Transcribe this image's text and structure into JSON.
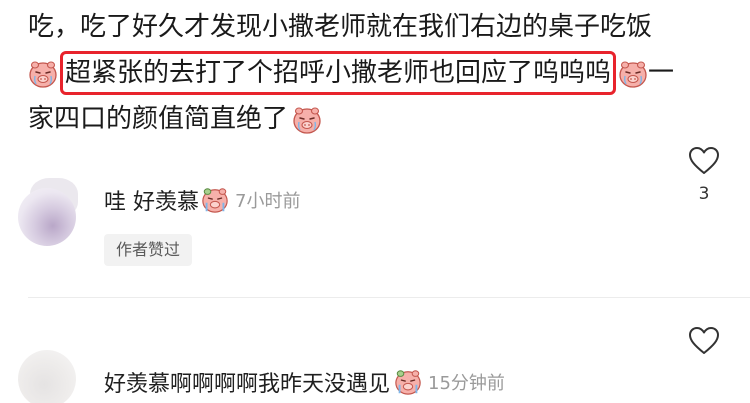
{
  "post": {
    "line1": "吃，吃了好久才发现小撒老师就在我们右边的桌子吃饭",
    "line2_highlighted": "超紧张的去打了个招呼小撒老师也回应了呜呜呜",
    "line2_tail": "一",
    "line3": "家四口的颜值简直绝了"
  },
  "comments": [
    {
      "text": "哇 好羡慕",
      "time": "7小时前",
      "badge": "作者赞过",
      "likes": "3"
    },
    {
      "text": "好羡慕啊啊啊啊我昨天没遇见",
      "time": "15分钟前"
    }
  ],
  "colors": {
    "highlight_border": "#e8232c",
    "face_fill": "#f6b0aa",
    "face_outline": "#c4584f"
  },
  "icons": {
    "emoji": "crying-pig-face-icon",
    "like": "heart-outline-icon"
  }
}
